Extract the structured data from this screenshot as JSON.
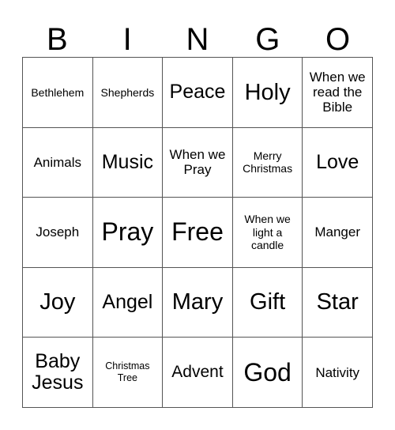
{
  "card": {
    "type": "bingo-card",
    "theme": "Christmas / Advent",
    "colors": {
      "background": "#ffffff",
      "text": "#000000",
      "grid_border": "#555555"
    }
  },
  "header": {
    "letters": [
      "B",
      "I",
      "N",
      "G",
      "O"
    ]
  },
  "grid": {
    "columns": 5,
    "rows": 5,
    "cells": [
      [
        {
          "text": "Bethlehem",
          "size": "sm"
        },
        {
          "text": "Shepherds",
          "size": "sm"
        },
        {
          "text": "Peace",
          "size": "xl"
        },
        {
          "text": "Holy",
          "size": "xxl"
        },
        {
          "text": "When we read the Bible",
          "size": "md"
        }
      ],
      [
        {
          "text": "Animals",
          "size": "md"
        },
        {
          "text": "Music",
          "size": "xl"
        },
        {
          "text": "When we Pray",
          "size": "md"
        },
        {
          "text": "Merry Christmas",
          "size": "sm"
        },
        {
          "text": "Love",
          "size": "xl"
        }
      ],
      [
        {
          "text": "Joseph",
          "size": "md"
        },
        {
          "text": "Pray",
          "size": "huge"
        },
        {
          "text": "Free",
          "size": "huge"
        },
        {
          "text": "When we light a candle",
          "size": "sm"
        },
        {
          "text": "Manger",
          "size": "md"
        }
      ],
      [
        {
          "text": "Joy",
          "size": "xxl"
        },
        {
          "text": "Angel",
          "size": "xl"
        },
        {
          "text": "Mary",
          "size": "xxl"
        },
        {
          "text": "Gift",
          "size": "xxl"
        },
        {
          "text": "Star",
          "size": "xxl"
        }
      ],
      [
        {
          "text": "Baby Jesus",
          "size": "xl"
        },
        {
          "text": "Christmas Tree",
          "size": "xs"
        },
        {
          "text": "Advent",
          "size": "lg"
        },
        {
          "text": "God",
          "size": "huge"
        },
        {
          "text": "Nativity",
          "size": "md"
        }
      ]
    ]
  }
}
